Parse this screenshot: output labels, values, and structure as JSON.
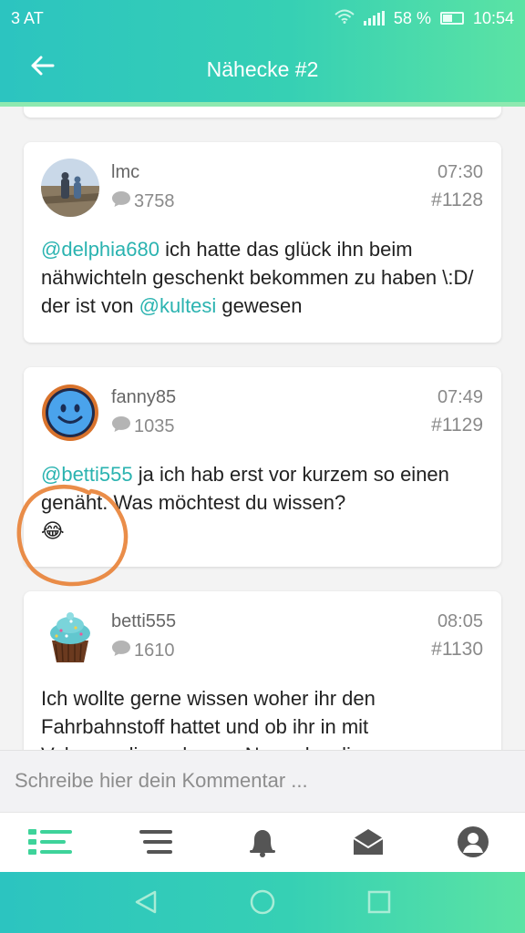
{
  "status_bar": {
    "carrier": "3 AT",
    "battery_percent": "58 %",
    "time": "10:54",
    "icons": [
      "wifi-icon",
      "signal-icon",
      "battery-icon"
    ]
  },
  "header": {
    "title": "Nähecke #2",
    "back_icon": "arrow-left-icon"
  },
  "posts": [
    {
      "username": "lmc",
      "count": "3758",
      "time": "07:30",
      "number": "#1128",
      "avatar": "photo-avatar",
      "segments": [
        {
          "text": "@delphia680",
          "type": "mention"
        },
        {
          "text": " ich hatte das glück ihn beim nähwichteln geschenkt bekommen zu haben \\:D/ der ist von ",
          "type": "text"
        },
        {
          "text": "@kultesi",
          "type": "mention"
        },
        {
          "text": " gewesen",
          "type": "text"
        }
      ]
    },
    {
      "username": "fanny85",
      "count": "1035",
      "time": "07:49",
      "number": "#1129",
      "avatar": "smiley-avatar",
      "segments": [
        {
          "text": "@betti555",
          "type": "mention"
        },
        {
          "text": " ja ich hab erst vor kurzem so einen genäht. Was möchtest du wissen?",
          "type": "text"
        }
      ],
      "emoji": "😂"
    },
    {
      "username": "betti555",
      "count": "1610",
      "time": "08:05",
      "number": "#1130",
      "avatar": "cupcake-avatar",
      "segments": [
        {
          "text": "Ich wollte gerne wissen woher ihr den Fahrbahnstoff hattet und ob ihr in mit Volumenvlies oder nur Normalenvlies",
          "type": "text"
        }
      ]
    }
  ],
  "comment": {
    "placeholder": "Schreibe hier dein Kommentar ..."
  },
  "tabs": [
    {
      "name": "tab-feed",
      "icon": "list-icon",
      "active": true
    },
    {
      "name": "tab-menu",
      "icon": "menu-lines-icon",
      "active": false
    },
    {
      "name": "tab-notifications",
      "icon": "bell-icon",
      "active": false
    },
    {
      "name": "tab-messages",
      "icon": "envelope-icon",
      "active": false
    },
    {
      "name": "tab-profile",
      "icon": "user-icon",
      "active": false
    }
  ],
  "colors": {
    "accent": "#2ab3b0",
    "header_gradient_start": "#2cc4c0",
    "header_gradient_end": "#5be3a4",
    "tab_active": "#3ed39a",
    "tab_inactive": "#555555",
    "annotation_circle": "#e8833a"
  }
}
